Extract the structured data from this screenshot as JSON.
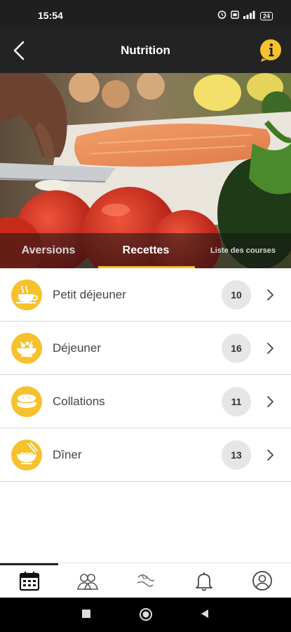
{
  "status_bar": {
    "time": "15:54",
    "battery": "24"
  },
  "app_bar": {
    "title": "Nutrition",
    "back_icon": "chevron-left-icon",
    "info_icon": "info-bubble-icon",
    "accent_color": "#f6c12c"
  },
  "tabs": [
    {
      "label": "Aversions",
      "active": false
    },
    {
      "label": "Recettes",
      "active": true
    },
    {
      "label": "Liste des courses",
      "active": false
    }
  ],
  "meal_list": [
    {
      "label": "Petit déjeuner",
      "count": "10",
      "icon": "coffee-cup-icon"
    },
    {
      "label": "Déjeuner",
      "count": "16",
      "icon": "salad-bowl-icon"
    },
    {
      "label": "Collations",
      "count": "11",
      "icon": "cookies-icon"
    },
    {
      "label": "Dîner",
      "count": "13",
      "icon": "noodle-bowl-icon"
    }
  ],
  "bottom_nav": [
    {
      "icon": "calendar-icon",
      "active": true
    },
    {
      "icon": "community-icon",
      "active": false
    },
    {
      "icon": "coaching-icon",
      "active": false
    },
    {
      "icon": "bell-icon",
      "active": false
    },
    {
      "icon": "profile-icon",
      "active": false
    }
  ]
}
